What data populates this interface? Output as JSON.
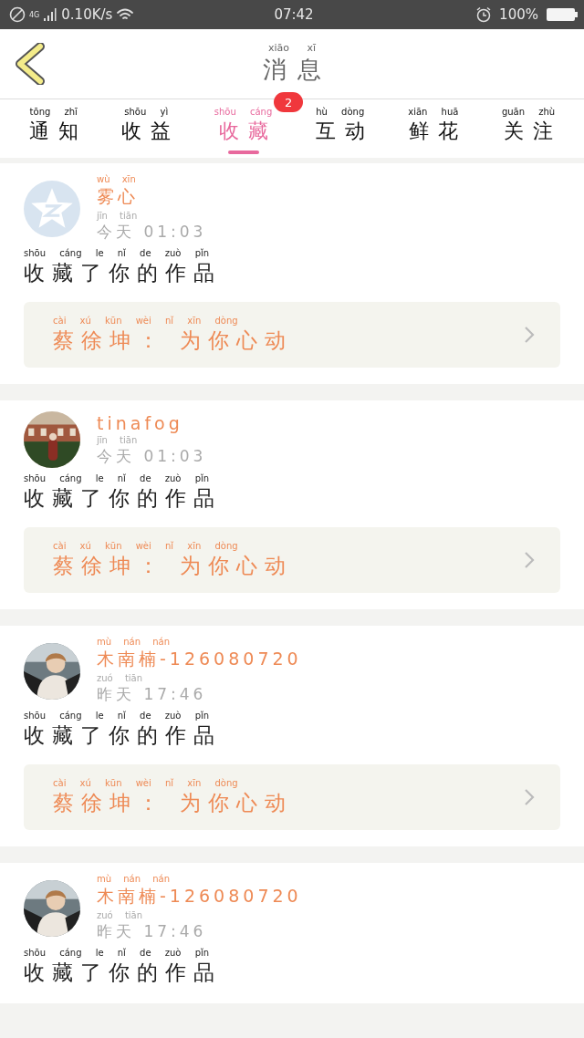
{
  "status_bar": {
    "network": "4G",
    "speed": "0.10K/s",
    "time": "07:42",
    "battery": "100%"
  },
  "header": {
    "title": "消息",
    "title_pinyin": "xiāo xī"
  },
  "tabs": [
    {
      "label": "通知",
      "pinyin": "tōng zhī",
      "selected": false
    },
    {
      "label": "收益",
      "pinyin": "shōu yì",
      "selected": false
    },
    {
      "label": "收藏",
      "pinyin": "shōu cáng",
      "selected": true,
      "badge": "2"
    },
    {
      "label": "互动",
      "pinyin": "hù dòng",
      "selected": false
    },
    {
      "label": "鲜花",
      "pinyin": "xiān huā",
      "selected": false
    },
    {
      "label": "关注",
      "pinyin": "guān zhù",
      "selected": false
    }
  ],
  "messages": [
    {
      "avatar": {
        "kind": "default"
      },
      "name": "雾心",
      "name_pinyin": "wù xīn",
      "time": "今天 01:03",
      "time_pinyin": "jīn tiān",
      "text": "收藏了你的作品",
      "text_pinyin": "shōu cáng le nǐ de zuò pǐn",
      "quote": "蔡徐坤： 为你心动",
      "quote_pinyin": "cài xú kūn wèi nǐ xīn dòng"
    },
    {
      "name": "tinafog",
      "time": "今天 01:03",
      "time_pinyin": "jīn tiān",
      "text": "收藏了你的作品",
      "text_pinyin": "shōu cáng le nǐ de zuò pǐn",
      "quote": "蔡徐坤： 为你心动",
      "quote_pinyin": "cài xú kūn wèi nǐ xīn dòng"
    },
    {
      "name": "木南楠-126080720",
      "name_pinyin": "mù nán nán",
      "time": "昨天 17:46",
      "time_pinyin": "zuó tiān",
      "text": "收藏了你的作品",
      "text_pinyin": "shōu cáng le nǐ de zuò pǐn",
      "quote": "蔡徐坤： 为你心动",
      "quote_pinyin": "cài xú kūn wèi nǐ xīn dòng"
    },
    {
      "name": "木南楠-126080720",
      "name_pinyin": "mù nán nán",
      "time": "昨天 17:46",
      "time_pinyin": "zuó tiān",
      "text": "收藏了你的作品",
      "text_pinyin": "shōu cáng le nǐ de zuò pǐn"
    }
  ]
}
